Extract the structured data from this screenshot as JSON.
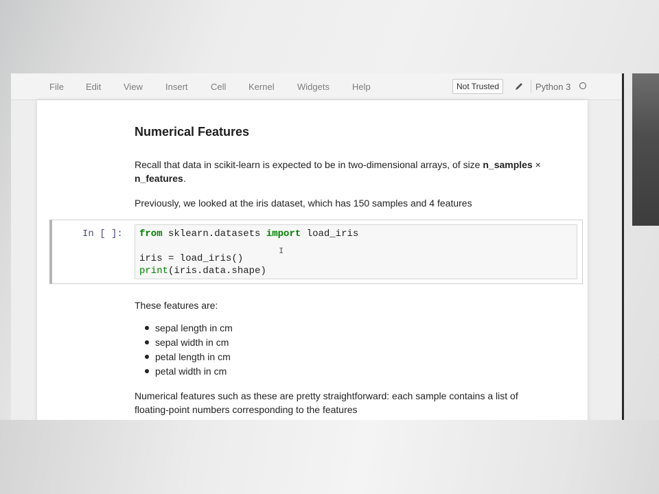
{
  "menu": {
    "items": [
      "File",
      "Edit",
      "View",
      "Insert",
      "Cell",
      "Kernel",
      "Widgets",
      "Help"
    ],
    "trust_label": "Not Trusted",
    "kernel_name": "Python 3"
  },
  "cells": {
    "heading": "Numerical Features",
    "intro_prefix": "Recall that data in scikit-learn is expected to be in two-dimensional arrays, of size ",
    "intro_bold_1": "n_samples",
    "intro_times": " × ",
    "intro_bold_2": "n_features",
    "intro_suffix": ".",
    "previously": "Previously, we looked at the iris dataset, which has 150 samples and 4 features",
    "code_prompt": "In [ ]:",
    "code": {
      "line1_kw1": "from",
      "line1_mod": " sklearn.datasets ",
      "line1_kw2": "import",
      "line1_rest": " load_iris",
      "line3": "iris = load_iris()",
      "line4_fn": "print",
      "line4_rest": "(iris.data.shape)"
    },
    "features_intro": "These features are:",
    "features": [
      "sepal length in cm",
      "sepal width in cm",
      "petal length in cm",
      "petal width in cm"
    ],
    "closing": "Numerical features such as these are pretty straightforward: each sample contains a list of floating-point numbers corresponding to the features"
  }
}
